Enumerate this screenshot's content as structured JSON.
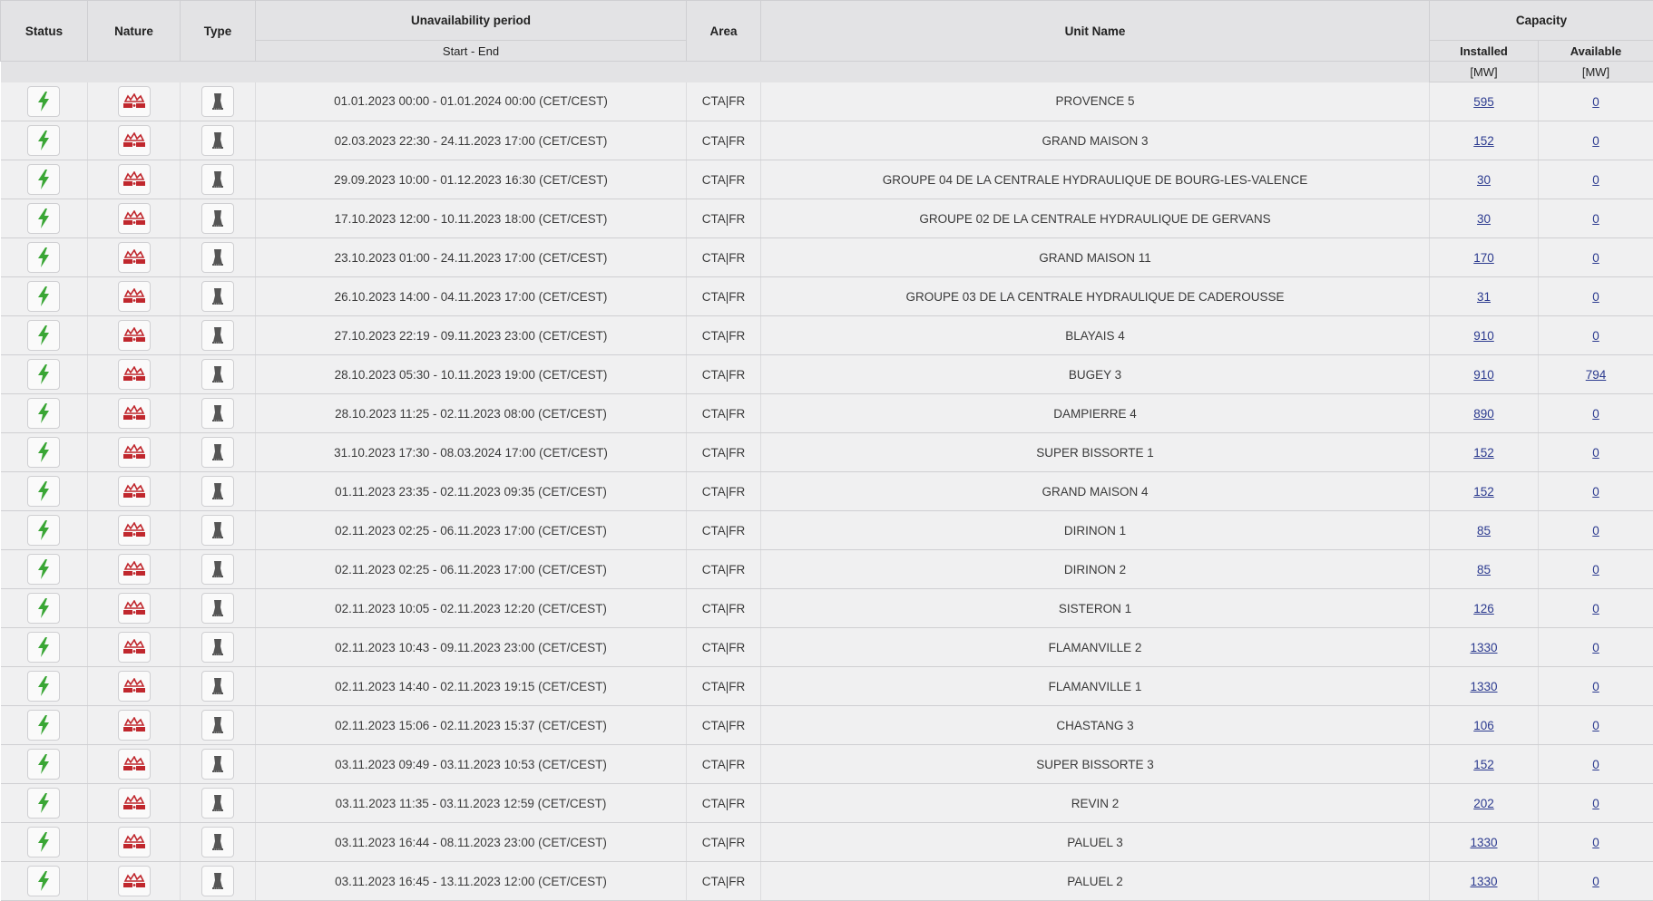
{
  "columns": {
    "status": "Status",
    "nature": "Nature",
    "type": "Type",
    "period": "Unavailability period",
    "period_sub": "Start - End",
    "area": "Area",
    "unit_name": "Unit Name",
    "capacity": "Capacity",
    "installed": "Installed",
    "available": "Available",
    "installed_unit": "[MW]",
    "available_unit": "[MW]"
  },
  "icons": {
    "status": "lightning-bolt-icon",
    "nature": "outage-explosion-icon",
    "type": "power-plant-tower-icon",
    "status_color": "#3aa635",
    "nature_color": "#c0272d",
    "type_color": "#555555",
    "link_color": "#2b3a8f"
  },
  "rows": [
    {
      "period": "01.01.2023 00:00 - 01.01.2024 00:00 (CET/CEST)",
      "area": "CTA|FR",
      "unit": "PROVENCE 5",
      "installed": "595",
      "available": "0"
    },
    {
      "period": "02.03.2023 22:30 - 24.11.2023 17:00 (CET/CEST)",
      "area": "CTA|FR",
      "unit": "GRAND MAISON 3",
      "installed": "152",
      "available": "0"
    },
    {
      "period": "29.09.2023 10:00 - 01.12.2023 16:30 (CET/CEST)",
      "area": "CTA|FR",
      "unit": "GROUPE 04 DE LA CENTRALE HYDRAULIQUE DE BOURG-LES-VALENCE",
      "installed": "30",
      "available": "0"
    },
    {
      "period": "17.10.2023 12:00 - 10.11.2023 18:00 (CET/CEST)",
      "area": "CTA|FR",
      "unit": "GROUPE 02 DE LA CENTRALE HYDRAULIQUE DE GERVANS",
      "installed": "30",
      "available": "0"
    },
    {
      "period": "23.10.2023 01:00 - 24.11.2023 17:00 (CET/CEST)",
      "area": "CTA|FR",
      "unit": "GRAND MAISON 11",
      "installed": "170",
      "available": "0"
    },
    {
      "period": "26.10.2023 14:00 - 04.11.2023 17:00 (CET/CEST)",
      "area": "CTA|FR",
      "unit": "GROUPE 03 DE LA CENTRALE HYDRAULIQUE DE CADEROUSSE",
      "installed": "31",
      "available": "0"
    },
    {
      "period": "27.10.2023 22:19 - 09.11.2023 23:00 (CET/CEST)",
      "area": "CTA|FR",
      "unit": "BLAYAIS 4",
      "installed": "910",
      "available": "0"
    },
    {
      "period": "28.10.2023 05:30 - 10.11.2023 19:00 (CET/CEST)",
      "area": "CTA|FR",
      "unit": "BUGEY 3",
      "installed": "910",
      "available": "794"
    },
    {
      "period": "28.10.2023 11:25 - 02.11.2023 08:00 (CET/CEST)",
      "area": "CTA|FR",
      "unit": "DAMPIERRE 4",
      "installed": "890",
      "available": "0"
    },
    {
      "period": "31.10.2023 17:30 - 08.03.2024 17:00 (CET/CEST)",
      "area": "CTA|FR",
      "unit": "SUPER BISSORTE 1",
      "installed": "152",
      "available": "0"
    },
    {
      "period": "01.11.2023 23:35 - 02.11.2023 09:35 (CET/CEST)",
      "area": "CTA|FR",
      "unit": "GRAND MAISON 4",
      "installed": "152",
      "available": "0"
    },
    {
      "period": "02.11.2023 02:25 - 06.11.2023 17:00 (CET/CEST)",
      "area": "CTA|FR",
      "unit": "DIRINON 1",
      "installed": "85",
      "available": "0"
    },
    {
      "period": "02.11.2023 02:25 - 06.11.2023 17:00 (CET/CEST)",
      "area": "CTA|FR",
      "unit": "DIRINON 2",
      "installed": "85",
      "available": "0"
    },
    {
      "period": "02.11.2023 10:05 - 02.11.2023 12:20 (CET/CEST)",
      "area": "CTA|FR",
      "unit": "SISTERON 1",
      "installed": "126",
      "available": "0"
    },
    {
      "period": "02.11.2023 10:43 - 09.11.2023 23:00 (CET/CEST)",
      "area": "CTA|FR",
      "unit": "FLAMANVILLE 2",
      "installed": "1330",
      "available": "0"
    },
    {
      "period": "02.11.2023 14:40 - 02.11.2023 19:15 (CET/CEST)",
      "area": "CTA|FR",
      "unit": "FLAMANVILLE 1",
      "installed": "1330",
      "available": "0"
    },
    {
      "period": "02.11.2023 15:06 - 02.11.2023 15:37 (CET/CEST)",
      "area": "CTA|FR",
      "unit": "CHASTANG 3",
      "installed": "106",
      "available": "0"
    },
    {
      "period": "03.11.2023 09:49 - 03.11.2023 10:53 (CET/CEST)",
      "area": "CTA|FR",
      "unit": "SUPER BISSORTE 3",
      "installed": "152",
      "available": "0"
    },
    {
      "period": "03.11.2023 11:35 - 03.11.2023 12:59 (CET/CEST)",
      "area": "CTA|FR",
      "unit": "REVIN 2",
      "installed": "202",
      "available": "0"
    },
    {
      "period": "03.11.2023 16:44 - 08.11.2023 23:00 (CET/CEST)",
      "area": "CTA|FR",
      "unit": "PALUEL 3",
      "installed": "1330",
      "available": "0"
    },
    {
      "period": "03.11.2023 16:45 - 13.11.2023 12:00 (CET/CEST)",
      "area": "CTA|FR",
      "unit": "PALUEL 2",
      "installed": "1330",
      "available": "0"
    }
  ]
}
